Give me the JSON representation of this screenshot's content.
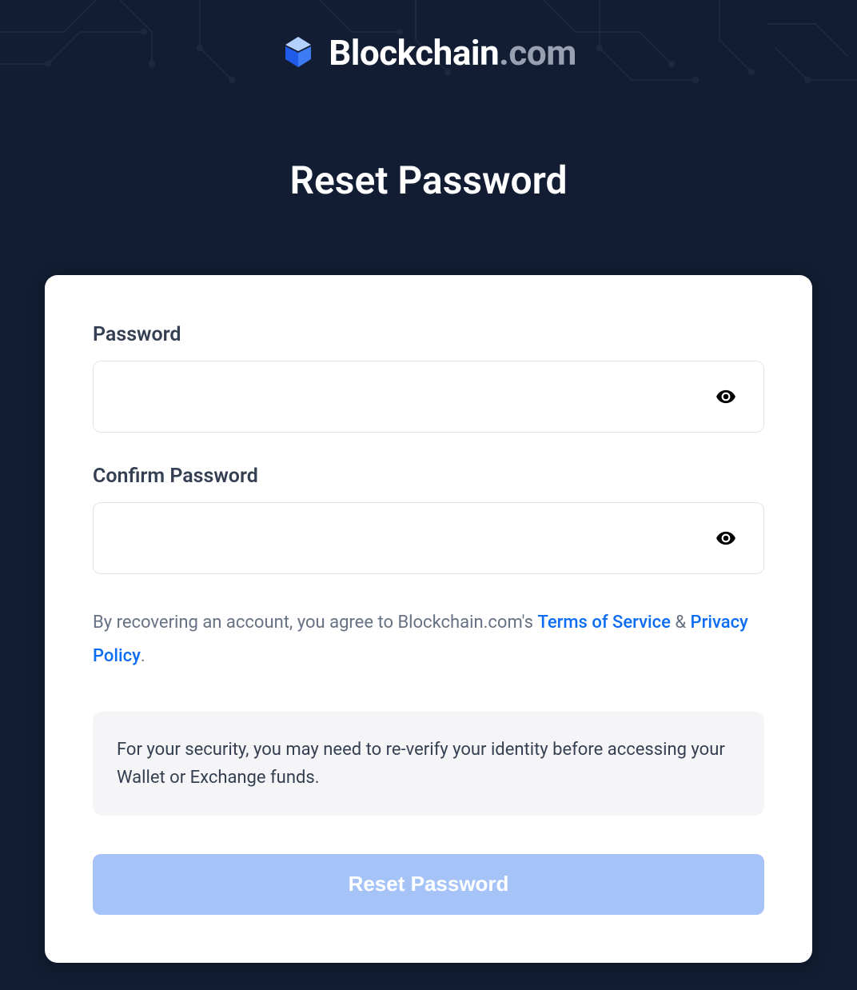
{
  "brand": {
    "name": "Blockchain",
    "suffix": ".com"
  },
  "page": {
    "title": "Reset Password"
  },
  "form": {
    "password_label": "Password",
    "confirm_label": "Confirm Password",
    "password_value": "",
    "confirm_value": ""
  },
  "agreement": {
    "prefix": "By recovering an account, you agree to Blockchain.com's ",
    "terms_label": "Terms of Service",
    "amp": " & ",
    "privacy_label": "Privacy Policy",
    "period": "."
  },
  "info_banner": {
    "text": "For your security, you may need to re-verify your identity before accessing your Wallet or Exchange funds."
  },
  "button": {
    "reset_label": "Reset Password"
  }
}
